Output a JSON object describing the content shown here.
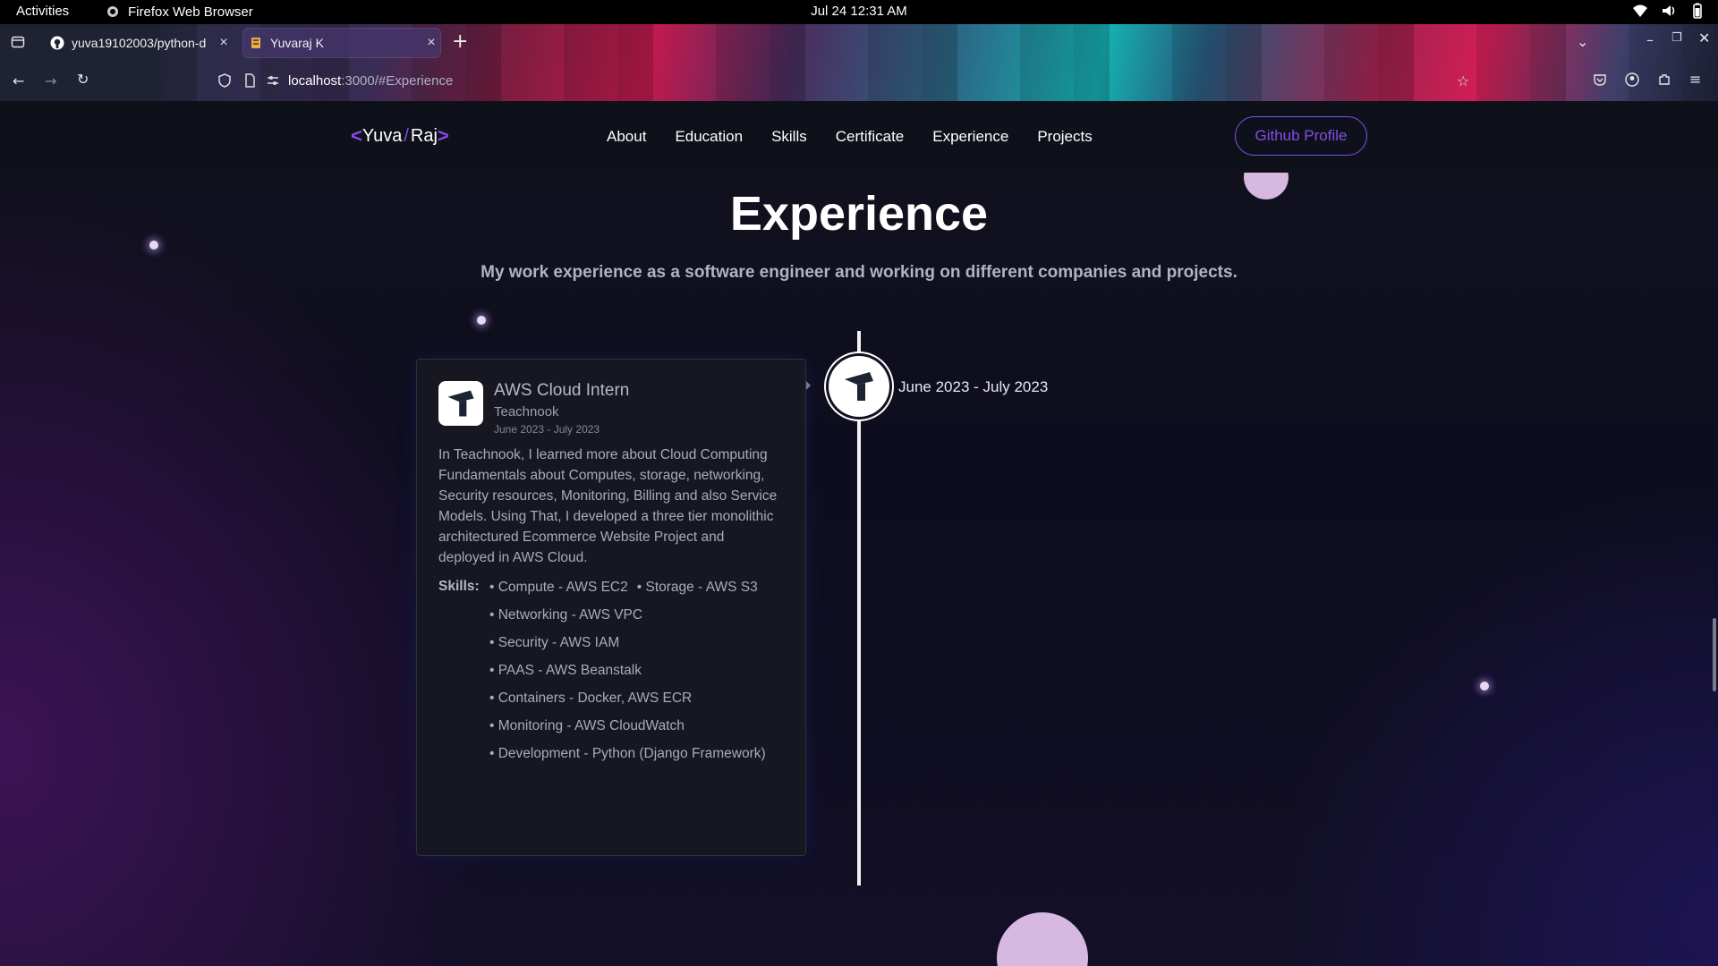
{
  "system": {
    "activities": "Activities",
    "app_name": "Firefox Web Browser",
    "clock": "Jul 24  12:31 AM"
  },
  "browser": {
    "tabs": [
      {
        "label": "yuva19102003/python-d",
        "icon": "github-icon"
      },
      {
        "label": "Yuvaraj K",
        "icon": "site-favicon",
        "active": true
      }
    ],
    "url_host": "localhost",
    "url_path": ":3000/#Experience"
  },
  "nav": {
    "logo_first": "Yuva",
    "logo_sep": "/",
    "logo_second": "Raj",
    "links": [
      "About",
      "Education",
      "Skills",
      "Certificate",
      "Experience",
      "Projects"
    ],
    "github_button": "Github Profile"
  },
  "section": {
    "title": "Experience",
    "subtitle": "My work experience as a software engineer and working on different companies and projects."
  },
  "experience": {
    "timeline_date": "June 2023 - July 2023",
    "role": "AWS Cloud Intern",
    "company": "Teachnook",
    "date": "June 2023 - July 2023",
    "description": "In Teachnook, I learned more about Cloud Computing Fundamentals about Computes, storage, networking, Security resources, Monitoring, Billing and also Service Models. Using That, I developed a three tier monolithic architectured Ecommerce Website Project and deployed in AWS Cloud.",
    "skills_label": "Skills:",
    "skills": [
      "• Compute - AWS EC2",
      "• Storage - AWS S3",
      "• Networking - AWS VPC",
      "• Security - AWS IAM",
      "• PAAS - AWS Beanstalk",
      "• Containers - Docker, AWS ECR",
      "• Monitoring - AWS CloudWatch",
      "• Development - Python (Django Framework)"
    ]
  },
  "colors": {
    "accent": "#854ce6",
    "nav_bg": "#0f111a",
    "card_bg": "#171721"
  }
}
